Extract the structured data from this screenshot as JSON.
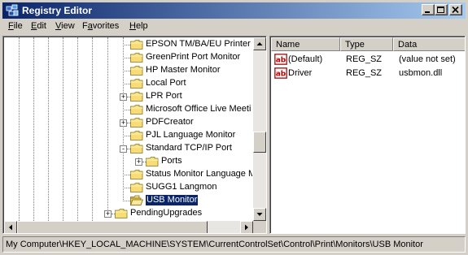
{
  "window": {
    "title": "Registry Editor"
  },
  "menu": [
    {
      "label_u": "F",
      "label_rest": "ile"
    },
    {
      "label_u": "E",
      "label_rest": "dit"
    },
    {
      "label_u": "V",
      "label_rest": "iew"
    },
    {
      "label_u": "",
      "label_rest": "Favorites",
      "label_pre": "F",
      "label_u2": "a",
      "label_rest2": "vorites"
    },
    {
      "label_u": "H",
      "label_rest": "elp"
    }
  ],
  "tree": {
    "nodes": [
      {
        "label": "EPSON TM/BA/EU Printer P",
        "expander": ""
      },
      {
        "label": "GreenPrint Port Monitor",
        "expander": ""
      },
      {
        "label": "HP Master Monitor",
        "expander": ""
      },
      {
        "label": "Local Port",
        "expander": ""
      },
      {
        "label": "LPR Port",
        "expander": "+"
      },
      {
        "label": "Microsoft Office Live Meeti",
        "expander": ""
      },
      {
        "label": "PDFCreator",
        "expander": "+"
      },
      {
        "label": "PJL Language Monitor",
        "expander": ""
      },
      {
        "label": "Standard TCP/IP Port",
        "expander": "-"
      },
      {
        "label": "Ports",
        "expander": "+"
      },
      {
        "label": "Status Monitor Language M",
        "expander": ""
      },
      {
        "label": "SUGG1 Langmon",
        "expander": ""
      },
      {
        "label": "USB Monitor",
        "expander": "",
        "selected": true
      },
      {
        "label": "PendingUpgrades",
        "expander": "+"
      }
    ]
  },
  "list": {
    "columns": [
      "Name",
      "Type",
      "Data"
    ],
    "rows": [
      {
        "name": "(Default)",
        "type": "REG_SZ",
        "data": "(value not set)"
      },
      {
        "name": "Driver",
        "type": "REG_SZ",
        "data": "usbmon.dll"
      }
    ]
  },
  "status": {
    "path": "My Computer\\HKEY_LOCAL_MACHINE\\SYSTEM\\CurrentControlSet\\Control\\Print\\Monitors\\USB Monitor"
  },
  "colors": {
    "titlebar_start": "#0a246a",
    "titlebar_end": "#a6caf0",
    "selection": "#0a246a",
    "face": "#d4d0c8"
  }
}
